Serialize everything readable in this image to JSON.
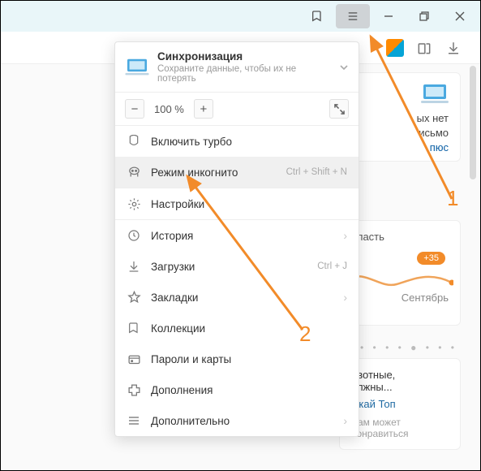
{
  "titlebar": {
    "menu_button": "menu"
  },
  "menu": {
    "sync": {
      "title": "Синхронизация",
      "subtitle": "Сохраните данные, чтобы их не потерять"
    },
    "zoom": {
      "minus": "−",
      "value": "100 %",
      "plus": "+"
    },
    "items": [
      {
        "label": "Включить турбо",
        "shortcut": "",
        "arrow": false,
        "hover": false
      },
      {
        "label": "Режим инкогнито",
        "shortcut": "Ctrl + Shift + N",
        "arrow": false,
        "hover": true
      },
      {
        "label": "Настройки",
        "shortcut": "",
        "arrow": false,
        "hover": false
      },
      {
        "label": "История",
        "shortcut": "",
        "arrow": true,
        "hover": false
      },
      {
        "label": "Загрузки",
        "shortcut": "Ctrl + J",
        "arrow": false,
        "hover": false
      },
      {
        "label": "Закладки",
        "shortcut": "",
        "arrow": true,
        "hover": false
      },
      {
        "label": "Коллекции",
        "shortcut": "",
        "arrow": false,
        "hover": false
      },
      {
        "label": "Пароли и карты",
        "shortcut": "",
        "arrow": false,
        "hover": false
      },
      {
        "label": "Дополнения",
        "shortcut": "",
        "arrow": false,
        "hover": false
      },
      {
        "label": "Дополнительно",
        "shortcut": "",
        "arrow": true,
        "hover": false
      }
    ]
  },
  "bg": {
    "card1": {
      "line1": "ых нет",
      "line2": "исьмо",
      "link": "пюс"
    },
    "card2": {
      "region": "бласть",
      "temp": "+35",
      "month": "Сентябрь"
    },
    "card3": {
      "t1": "ивотные,",
      "t2": "олжны...",
      "t3": "Скай Топ",
      "t4": "Вам может понравиться"
    }
  },
  "annotation": {
    "n1": "1",
    "n2": "2"
  },
  "colors": {
    "accent": "#f28b29"
  }
}
